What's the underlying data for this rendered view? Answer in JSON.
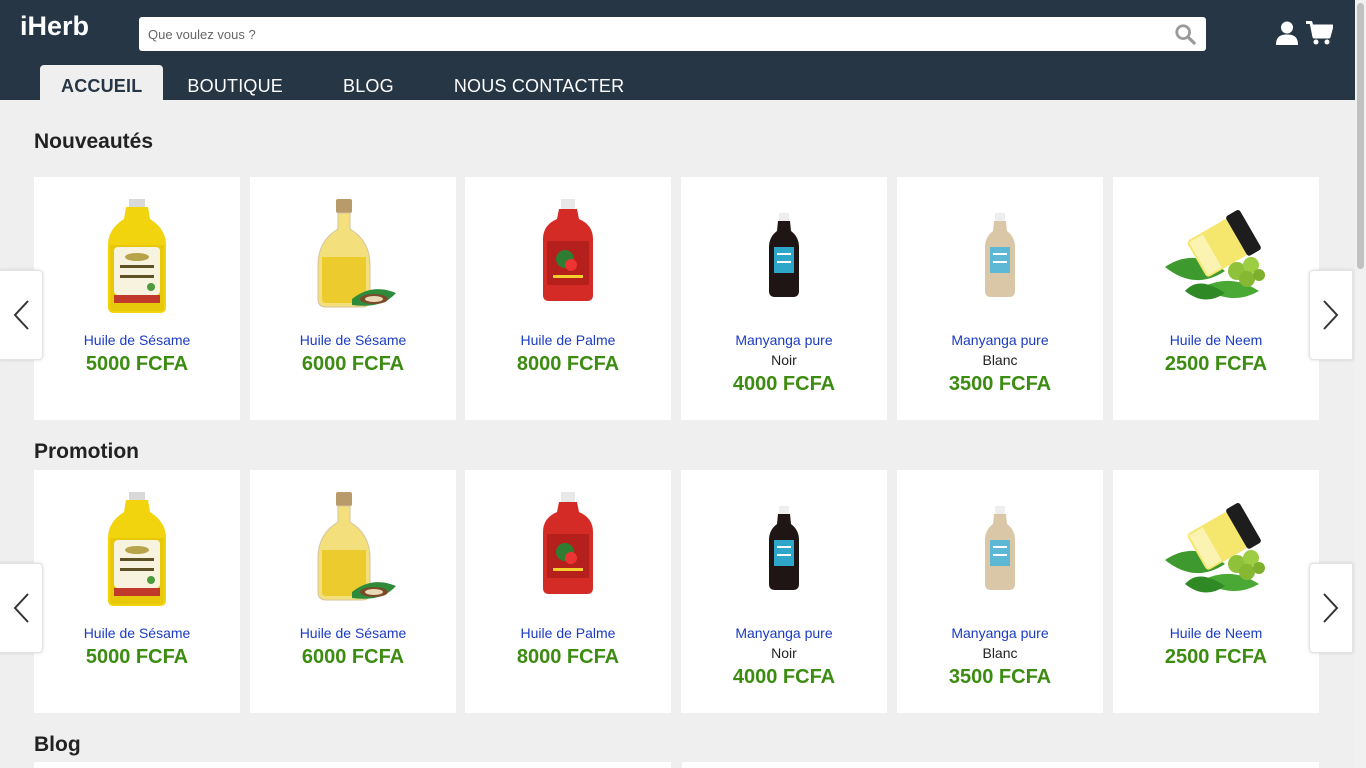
{
  "header": {
    "logo": "iHerb",
    "search_placeholder": "Que voulez vous ?",
    "icons": [
      "search-icon",
      "user-icon",
      "cart-icon"
    ]
  },
  "nav": {
    "items": [
      {
        "label": "ACCUEIL",
        "active": true
      },
      {
        "label": "BOUTIQUE",
        "active": false
      },
      {
        "label": "BLOG",
        "active": false
      },
      {
        "label": "NOUS CONTACTER",
        "active": false
      }
    ]
  },
  "sections": [
    {
      "title": "Nouveautés",
      "products": [
        {
          "name": "Huile de Sésame",
          "variant": "",
          "price": "5000 FCFA",
          "image": "sesame-oil-bottle"
        },
        {
          "name": "Huile de Sésame",
          "variant": "",
          "price": "6000 FCFA",
          "image": "sesame-oil-glass-bottle"
        },
        {
          "name": "Huile de Palme",
          "variant": "",
          "price": "8000 FCFA",
          "image": "palm-oil-bottle"
        },
        {
          "name": "Manyanga pure",
          "variant": "Noir",
          "price": "4000 FCFA",
          "image": "manyanga-black-bottle"
        },
        {
          "name": "Manyanga pure",
          "variant": "Blanc",
          "price": "3500 FCFA",
          "image": "manyanga-white-bottle"
        },
        {
          "name": "Huile de Neem",
          "variant": "",
          "price": "2500 FCFA",
          "image": "neem-oil-jar"
        }
      ]
    },
    {
      "title": "Promotion",
      "products": [
        {
          "name": "Huile de Sésame",
          "variant": "",
          "price": "5000 FCFA",
          "image": "sesame-oil-bottle"
        },
        {
          "name": "Huile de Sésame",
          "variant": "",
          "price": "6000 FCFA",
          "image": "sesame-oil-glass-bottle"
        },
        {
          "name": "Huile de Palme",
          "variant": "",
          "price": "8000 FCFA",
          "image": "palm-oil-bottle"
        },
        {
          "name": "Manyanga pure",
          "variant": "Noir",
          "price": "4000 FCFA",
          "image": "manyanga-black-bottle"
        },
        {
          "name": "Manyanga pure",
          "variant": "Blanc",
          "price": "3500 FCFA",
          "image": "manyanga-white-bottle"
        },
        {
          "name": "Huile de Neem",
          "variant": "",
          "price": "2500 FCFA",
          "image": "neem-oil-jar"
        }
      ]
    },
    {
      "title": "Blog",
      "products": []
    }
  ],
  "colors": {
    "header_bg": "#273645",
    "page_bg": "#efefef",
    "product_name": "#1a3bc2",
    "price": "#3d8c12"
  }
}
